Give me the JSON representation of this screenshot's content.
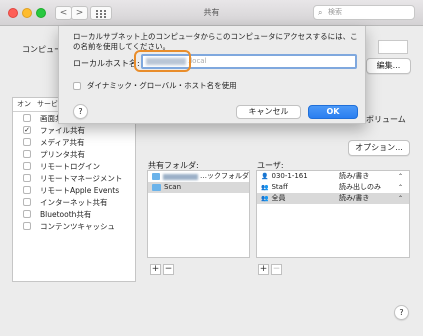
{
  "window": {
    "title": "共有"
  },
  "toolbar": {
    "back_label": "<",
    "forward_label": ">",
    "search_placeholder": "検索"
  },
  "background": {
    "computer_name_label": "コンピュータ名:",
    "edit_button_label": "編集...",
    "services_header": {
      "on": "オン",
      "service": "サービス"
    },
    "services": [
      {
        "label": "画面共有",
        "checked": false
      },
      {
        "label": "ファイル共有",
        "checked": true
      },
      {
        "label": "メディア共有",
        "checked": false
      },
      {
        "label": "プリンタ共有",
        "checked": false
      },
      {
        "label": "リモートログイン",
        "checked": false
      },
      {
        "label": "リモートマネージメント",
        "checked": false
      },
      {
        "label": "リモートApple Events",
        "checked": false
      },
      {
        "label": "インターネット共有",
        "checked": false
      },
      {
        "label": "Bluetooth共有",
        "checked": false
      },
      {
        "label": "コンテンツキャッシュ",
        "checked": false
      }
    ],
    "volume_text": "ボリューム",
    "options_button_label": "オプション...",
    "shared_folders_label": "共有フォルダ:",
    "shared_folders": [
      {
        "name": "…ックフォルダ"
      },
      {
        "name": "Scan"
      }
    ],
    "users_label": "ユーザ:",
    "users": [
      {
        "name": "030-1-161",
        "permission": "読み/書き"
      },
      {
        "name": "Staff",
        "permission": "読み出しのみ"
      },
      {
        "name": "全員",
        "permission": "読み/書き"
      }
    ],
    "plus_label": "+",
    "minus_label": "−",
    "help_label": "?"
  },
  "sheet": {
    "message": "ローカルサブネット上のコンピュータからこのコンピュータにアクセスするには、この名前を使用してください。",
    "hostname_label": "ローカルホスト名:",
    "hostname_suffix": ".local",
    "dynamic_label": "ダイナミック・グローバル・ホスト名を使用",
    "help_label": "?",
    "cancel_label": "キャンセル",
    "ok_label": "OK"
  },
  "colors": {
    "accent": "#2a7ef0",
    "highlight": "#e98d2b",
    "focus_ring": "#7fa8de"
  }
}
